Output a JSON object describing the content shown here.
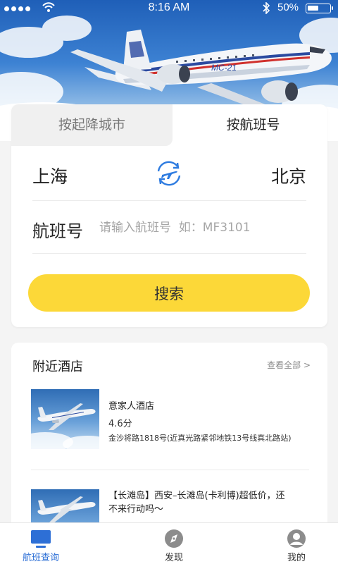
{
  "status_bar": {
    "time": "8:16 AM",
    "battery": "50%"
  },
  "search_card": {
    "tabs": [
      {
        "label": "按起降城市",
        "active": false
      },
      {
        "label": "按航班号",
        "active": true
      }
    ],
    "from_city": "上海",
    "to_city": "北京",
    "flight_label": "航班号",
    "flight_placeholder": "请输入航班号  如：MF3101",
    "search_label": "搜索"
  },
  "hotels": {
    "title": "附近酒店",
    "view_all": "查看全部 >",
    "items": [
      {
        "name": "意家人酒店",
        "score": "4.6分",
        "address": "金沙将路1818号(近真光路紧邻地铁13号线真北路站)"
      },
      {
        "description": "【长滩岛】西安–长滩岛(卡利博)超低价，还不来行动吗～"
      }
    ]
  },
  "tabbar": {
    "items": [
      {
        "label": "航班查询",
        "icon": "monitor-icon",
        "active": true
      },
      {
        "label": "发现",
        "icon": "compass-icon",
        "active": false
      },
      {
        "label": "我的",
        "icon": "user-icon",
        "active": false
      }
    ]
  },
  "colors": {
    "accent_yellow": "#fcd838",
    "accent_blue": "#2d6fd6",
    "background": "#f4f4f4"
  }
}
